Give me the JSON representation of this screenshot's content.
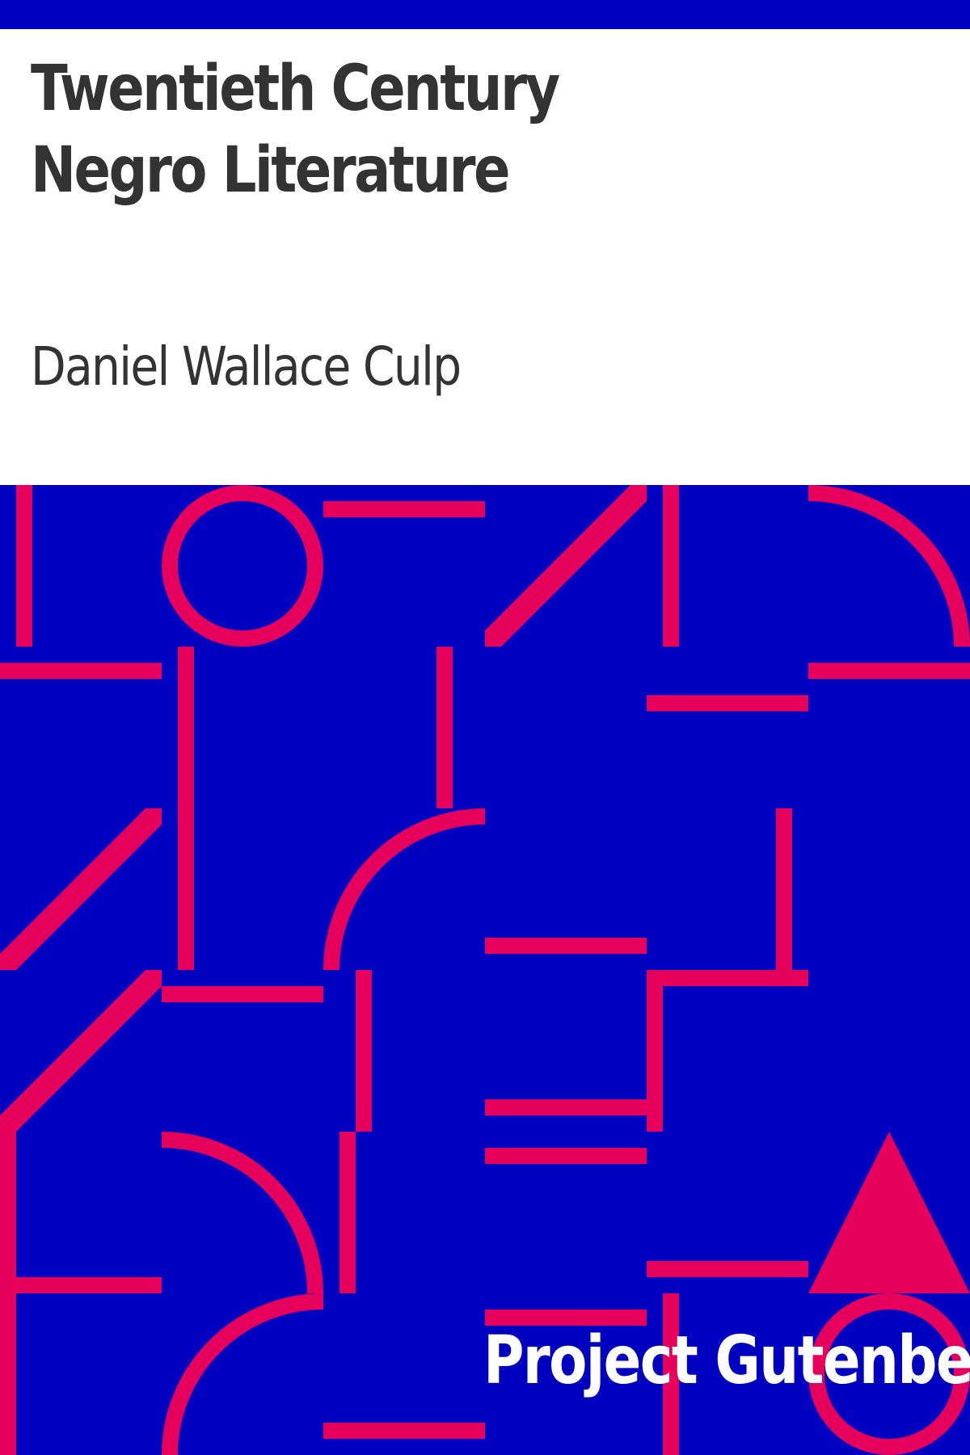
{
  "cover": {
    "title": "Twentieth Century Negro Literature",
    "author": "Daniel Wallace Culp",
    "publisher": "Project Gutenberg"
  },
  "colors": {
    "background": "#0000c0",
    "pattern": "#e6005c",
    "panel": "#ffffff",
    "title_text": "#333333",
    "publisher_text": "#ffffff"
  }
}
